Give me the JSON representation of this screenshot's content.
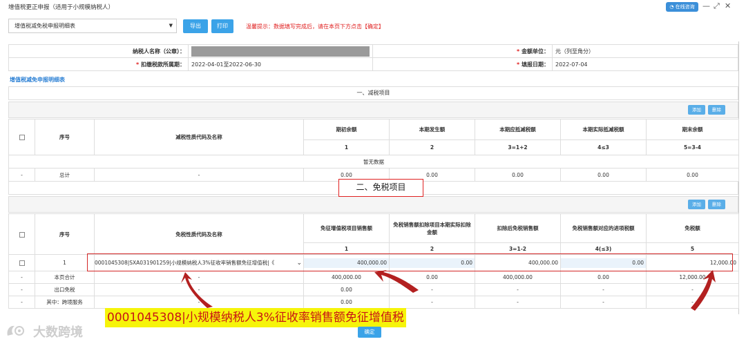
{
  "window": {
    "title": "增值税更正申报（适用于小规模纳税人）",
    "online_label": "在线咨询",
    "min_glyph": "—",
    "max_glyph": "⤢",
    "close_glyph": "✕"
  },
  "toolbar": {
    "form_select": "增值税减免税申报明细表",
    "export_label": "导出",
    "print_label": "打印",
    "tip": "温馨提示：数据填写完成后，请在本页下方点击【确定】"
  },
  "info": {
    "taxpayer_label": "纳税人名称（公章）：",
    "currency_label": "金额单位：",
    "currency_value": "元（列至角分）",
    "period_label": "扣缴税款所属期：",
    "period_value": "2022-04-01至2022-06-30",
    "fill_date_label": "填报日期：",
    "fill_date_value": "2022-07-04",
    "required_mark": "*"
  },
  "section_title": "增值税减免申报明细表",
  "reduction": {
    "title": "一、减税项目",
    "add_label": "添加",
    "delete_label": "删除",
    "headers": {
      "seq": "序号",
      "code": "减税性质代码及名称",
      "c1": "期初余额",
      "c2": "本期发生额",
      "c3": "本期应抵减税额",
      "c4": "本期实际抵减税额",
      "c5": "期末余额"
    },
    "formulas": [
      "1",
      "2",
      "3=1+2",
      "4≤3",
      "5=3-4"
    ],
    "no_data": "暂无数据",
    "total": {
      "dash": "-",
      "label": "总计",
      "code": "-",
      "values": [
        "0.00",
        "0.00",
        "0.00",
        "0.00",
        "0.00"
      ]
    }
  },
  "exemption": {
    "title": "二、免税项目",
    "add_label": "添加",
    "delete_label": "删除",
    "headers": {
      "seq": "序号",
      "code": "免税性质代码及名称",
      "c1": "免征增值税项目销售额",
      "c2": "免税销售额扣除项目本期实际扣除金额",
      "c3": "扣除后免税销售额",
      "c4": "免税销售额对应的进项税额",
      "c5": "免税额"
    },
    "formulas": [
      "1",
      "2",
      "3=1-2",
      "4(≤3)",
      "5"
    ],
    "row1": {
      "seq": "1",
      "code": "0001045308|SXA031901259|小规模纳税人3%征收率销售额免征增值税|《",
      "values": [
        "400,000.00",
        "0.00",
        "400,000.00",
        "0.00",
        "12,000.00"
      ]
    },
    "summary_rows": [
      {
        "dash": "-",
        "label": "本页合计",
        "code": "-",
        "values": [
          "400,000.00",
          "0.00",
          "400,000.00",
          "0.00",
          "12,000.00"
        ]
      },
      {
        "dash": "-",
        "label": "出口免税",
        "code": "-",
        "values": [
          "0.00",
          "-",
          "-",
          "-",
          "-"
        ]
      },
      {
        "dash": "-",
        "label": "其中：跨境服务",
        "code": "-",
        "values": [
          "0.00",
          "-",
          "-",
          "-",
          "-"
        ]
      }
    ]
  },
  "annotation_banner": "0001045308|小规模纳税人3%征收率销售额免征增值税",
  "watermark": "大数跨境",
  "confirm_label": "确定",
  "colors": {
    "accent": "#3ba3e8",
    "alert": "#e02020",
    "highlight": "#f6f40a"
  }
}
